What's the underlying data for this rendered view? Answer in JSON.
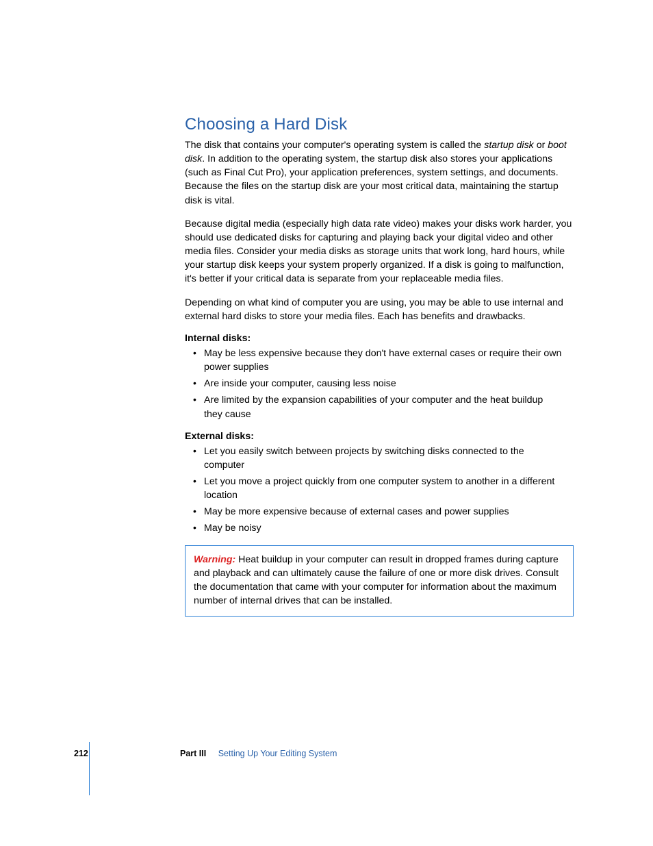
{
  "heading": "Choosing a Hard Disk",
  "p1_a": "The disk that contains your computer's operating system is called the ",
  "p1_i1": "startup disk",
  "p1_b": " or ",
  "p1_i2": "boot disk",
  "p1_c": ". In addition to the operating system, the startup disk also stores your applications (such as Final Cut Pro), your application preferences, system settings, and documents. Because the files on the startup disk are your most critical data, maintaining the startup disk is vital.",
  "p2": "Because digital media (especially high data rate video) makes your disks work harder, you should use dedicated disks for capturing and playing back your digital video and other media files. Consider your media disks as storage units that work long, hard hours, while your startup disk keeps your system properly organized. If a disk is going to malfunction, it's better if your critical data is separate from your replaceable media files.",
  "p3": "Depending on what kind of computer you are using, you may be able to use internal and external hard disks to store your media files. Each has benefits and drawbacks.",
  "internal": {
    "label": "Internal disks:",
    "items": [
      "May be less expensive because they don't have external cases or require their own power supplies",
      "Are inside your computer, causing less noise",
      "Are limited by the expansion capabilities of your computer and the heat buildup they cause"
    ]
  },
  "external": {
    "label": "External disks:",
    "items": [
      "Let you easily switch between projects by switching disks connected to the computer",
      "Let you move a project quickly from one computer system to another in a different location",
      "May be more expensive because of external cases and power supplies",
      "May be noisy"
    ]
  },
  "warning": {
    "label": "Warning:",
    "text": "  Heat buildup in your computer can result in dropped frames during capture and playback and can ultimately cause the failure of one or more disk drives. Consult the documentation that came with your computer for information about the maximum number of internal drives that can be installed."
  },
  "footer": {
    "page": "212",
    "part": "Part III",
    "title": "Setting Up Your Editing System"
  }
}
